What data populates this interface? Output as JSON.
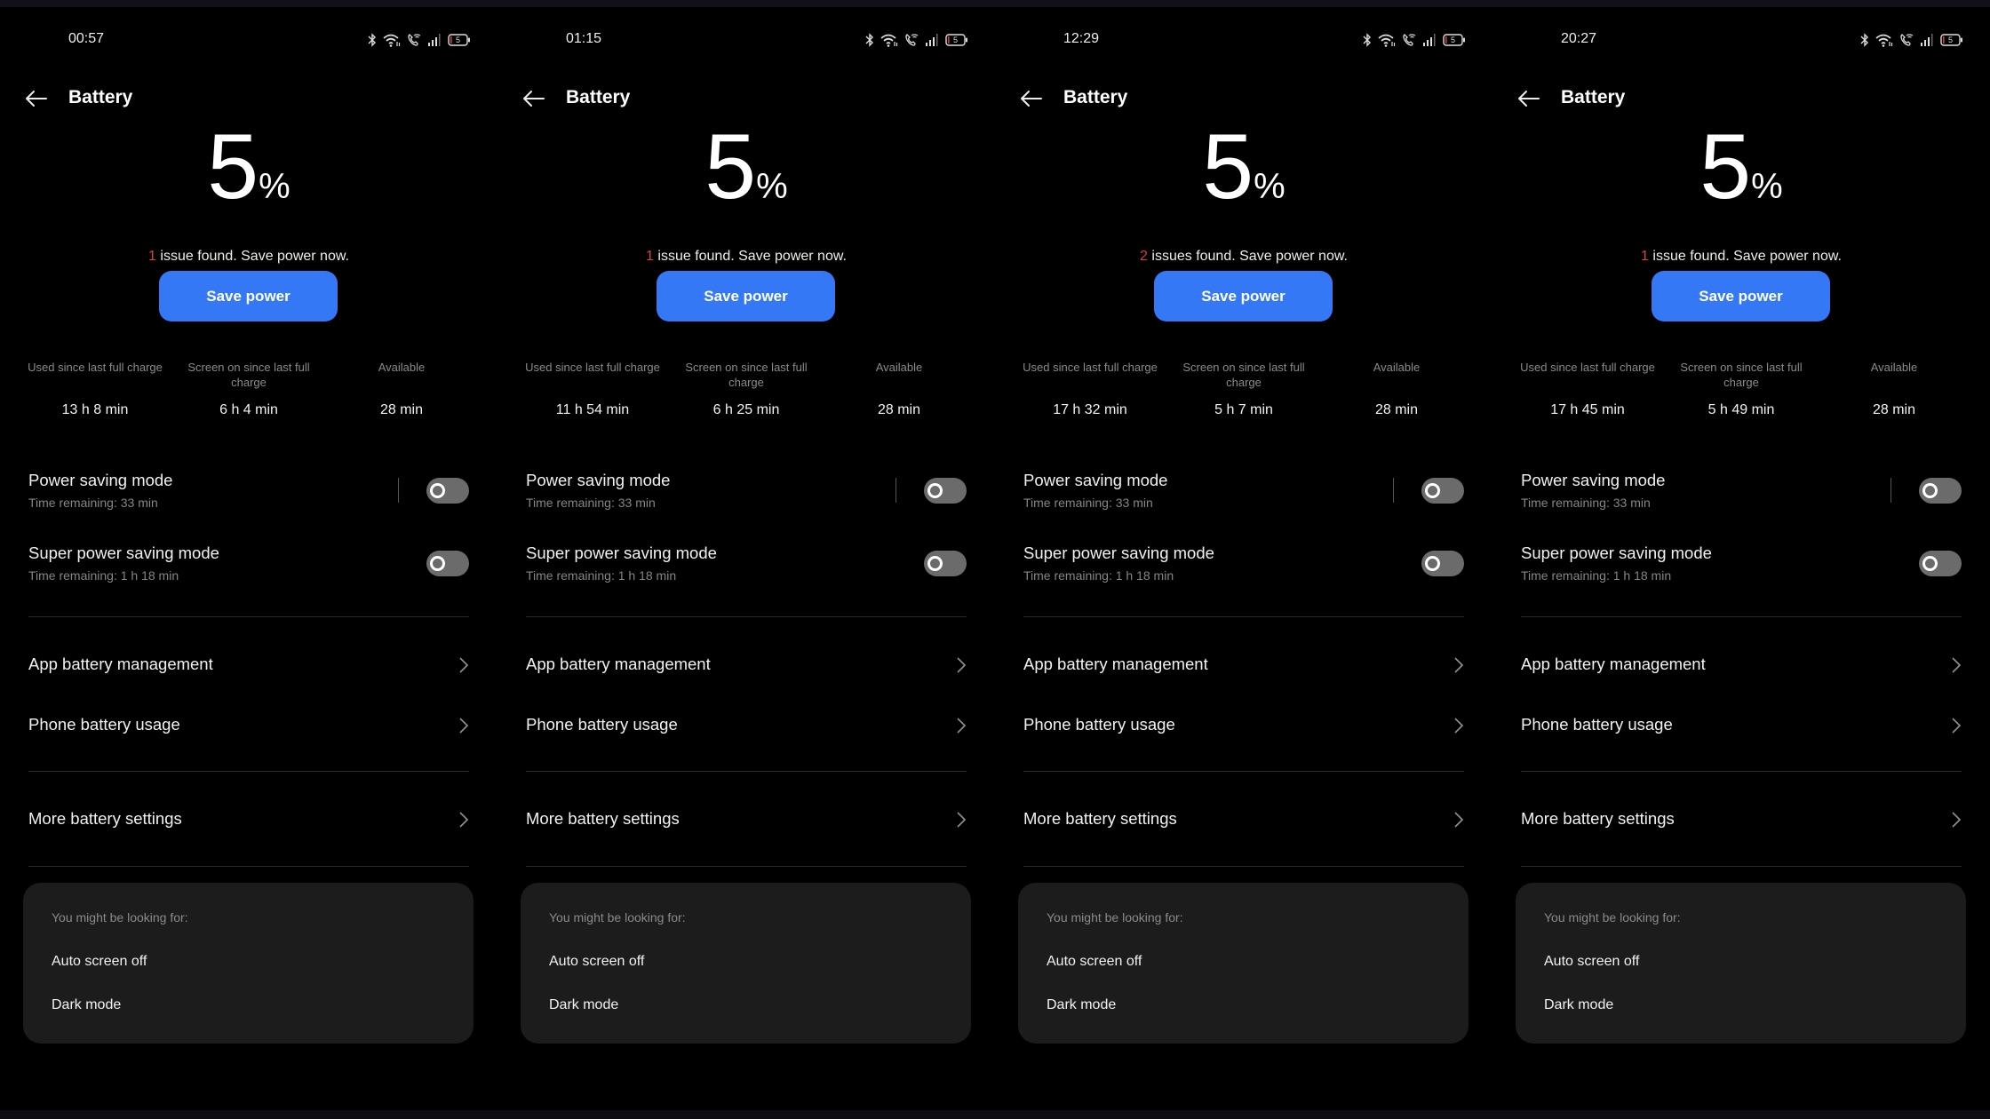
{
  "common": {
    "title": "Battery",
    "percent_sign": "%",
    "save_button_label": "Save power",
    "issue_suffix_singular": "issue found. Save power now.",
    "issue_suffix_plural": "issues found. Save power now.",
    "stat_labels": {
      "used": "Used since last full charge",
      "screen_on": "Screen on since last full charge",
      "available": "Available"
    },
    "power_saving_mode": {
      "title": "Power saving mode",
      "subtitle": "Time remaining:  33 min",
      "enabled": false
    },
    "super_power_saving_mode": {
      "title": "Super power saving mode",
      "subtitle": "Time remaining:  1 h 18 min",
      "enabled": false
    },
    "nav_items": [
      "App battery management",
      "Phone battery usage",
      "More battery settings"
    ],
    "suggestions": {
      "heading": "You might be looking for:",
      "items": [
        "Auto screen off",
        "Dark mode"
      ]
    },
    "status_icons": [
      "bluetooth-icon",
      "wifi-icon",
      "wifi-calling-icon",
      "signal-icon",
      "battery-icon"
    ],
    "colors": {
      "accent": "#3478f6",
      "issue_count": "#d6403a",
      "background": "#000000",
      "card": "#1c1c1c",
      "toggle_track": "#6b6b6b"
    }
  },
  "panels": [
    {
      "status_time": "00:57",
      "battery_level_icon": "5",
      "battery_percent": "5",
      "issue_count": "1",
      "issue_text": "issue found. Save power now.",
      "stats": {
        "used": "13 h 8 min",
        "screen_on": "6 h 4 min",
        "available": "28 min"
      }
    },
    {
      "status_time": "01:15",
      "battery_level_icon": "5",
      "battery_percent": "5",
      "issue_count": "1",
      "issue_text": "issue found. Save power now.",
      "stats": {
        "used": "11 h 54 min",
        "screen_on": "6 h 25 min",
        "available": "28 min"
      }
    },
    {
      "status_time": "12:29",
      "battery_level_icon": "5",
      "battery_percent": "5",
      "issue_count": "2",
      "issue_text": "issues found. Save power now.",
      "stats": {
        "used": "17 h 32 min",
        "screen_on": "5 h 7 min",
        "available": "28 min"
      }
    },
    {
      "status_time": "20:27",
      "battery_level_icon": "5",
      "battery_percent": "5",
      "issue_count": "1",
      "issue_text": "issue found. Save power now.",
      "stats": {
        "used": "17 h 45 min",
        "screen_on": "5 h 49 min",
        "available": "28 min"
      }
    }
  ]
}
